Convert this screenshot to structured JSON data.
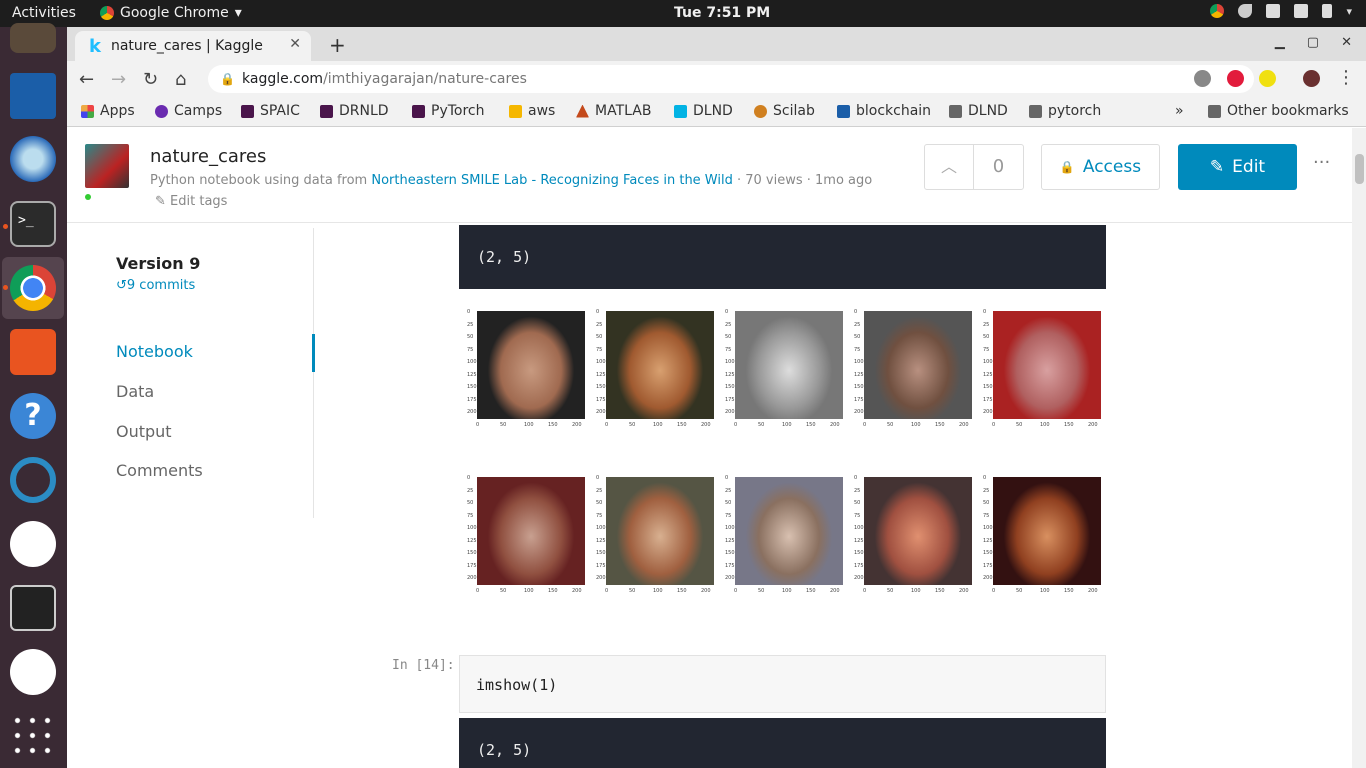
{
  "system": {
    "activities": "Activities",
    "app_name": "Google Chrome",
    "clock": "Tue  7:51 PM"
  },
  "browser": {
    "tab_title": "nature_cares | Kaggle",
    "url_domain": "kaggle.com",
    "url_path": "/imthiyagarajan/nature-cares",
    "bookmarks": [
      "Apps",
      "Camps",
      "SPAIC",
      "DRNLD",
      "PyTorch",
      "aws",
      "MATLAB",
      "DLND",
      "Scilab",
      "blockchain",
      "DLND",
      "pytorch"
    ],
    "other_bookmarks": "Other bookmarks",
    "more": "»"
  },
  "kaggle": {
    "title": "nature_cares",
    "subtitle_prefix": "Python notebook using data from ",
    "dataset_link": "Northeastern SMILE Lab - Recognizing Faces in the Wild",
    "subtitle_suffix": " · 70 views · 1mo ago",
    "edit_tags": "Edit tags",
    "vote_count": "0",
    "access_label": "Access",
    "edit_label": "Edit",
    "more_label": "···",
    "version": "Version 9",
    "commits": "9 commits",
    "nav": [
      "Notebook",
      "Data",
      "Output",
      "Comments"
    ]
  },
  "notebook": {
    "output1": "(2, 5)",
    "input_prompt": "In [14]:",
    "input_code": "imshow(1)",
    "output2": "(2, 5)",
    "yticks": [
      "0",
      "25",
      "50",
      "75",
      "100",
      "125",
      "150",
      "175",
      "200"
    ],
    "xticks": [
      "0",
      "50",
      "100",
      "150",
      "200"
    ]
  },
  "colors": {
    "accent": "#008abc",
    "output_bg": "#222631",
    "dock_bg": "#3a2a34"
  }
}
